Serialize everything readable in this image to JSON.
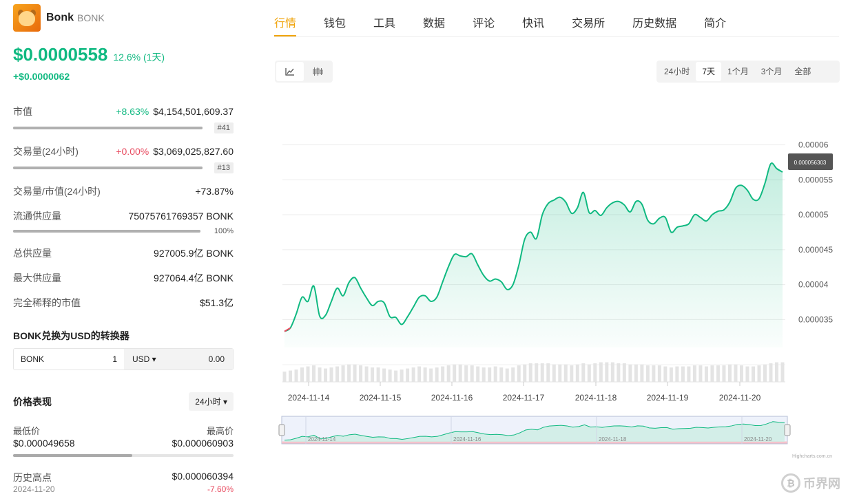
{
  "coin": {
    "name": "Bonk",
    "symbol": "BONK"
  },
  "price": {
    "value": "$0.0000558",
    "change_pct": "12.6% (1天)",
    "change_abs": "+$0.0000062"
  },
  "stats": {
    "market_cap": {
      "label": "市值",
      "change": "+8.63%",
      "value": "$4,154,501,609.37",
      "rank": "#41"
    },
    "volume": {
      "label": "交易量(24小时)",
      "change": "+0.00%",
      "value": "$3,069,025,827.60",
      "rank": "#13"
    },
    "vol_mcap": {
      "label": "交易量/市值(24小时)",
      "value": "+73.87%"
    },
    "circulating": {
      "label": "流通供应量",
      "value": "75075761769357 BONK",
      "pct": "100%",
      "pct_num": 100
    },
    "total_supply": {
      "label": "总供应量",
      "value": "927005.9亿 BONK"
    },
    "max_supply": {
      "label": "最大供应量",
      "value": "927064.4亿 BONK"
    },
    "fdv": {
      "label": "完全稀释的市值",
      "value": "$51.3亿"
    }
  },
  "converter": {
    "title": "BONK兑换为USD的转换器",
    "from_symbol": "BONK",
    "from_amount": "1",
    "to_currency": "USD ▾",
    "to_amount": "0.00"
  },
  "performance": {
    "title": "价格表现",
    "period": "24小时 ▾",
    "low_label": "最低价",
    "high_label": "最高价",
    "low": "$0.000049658",
    "high": "$0.000060903",
    "position_pct": 54,
    "ath_label": "历史高点",
    "ath_value": "$0.000060394",
    "ath_date": "2024-11-20",
    "ath_change": "-7.60%"
  },
  "tabs": [
    "行情",
    "钱包",
    "工具",
    "数据",
    "评论",
    "快讯",
    "交易所",
    "历史数据",
    "简介"
  ],
  "range_tabs": [
    "24小时",
    "7天",
    "1个月",
    "3个月",
    "全部"
  ],
  "active_range": "7天",
  "chart_icons": [
    "line-chart-icon",
    "candlestick-icon"
  ],
  "colors": {
    "up": "#10b981",
    "down": "#e84a5f",
    "accent": "#f0a40c"
  },
  "credit": "Highcharts.com.cn",
  "watermark": "币界网",
  "chart_data": {
    "type": "area",
    "x_labels": [
      "2024-11-14",
      "2024-11-15",
      "2024-11-16",
      "2024-11-17",
      "2024-11-18",
      "2024-11-19",
      "2024-11-20"
    ],
    "y_ticks": [
      "0.00006",
      "0.000055",
      "0.00005",
      "0.000045",
      "0.00004",
      "0.000035"
    ],
    "ylim": [
      3.1e-05,
      6.3e-05
    ],
    "tooltip": "0.000056303",
    "navigator_labels": [
      "2024-11-14",
      "2024-11-16",
      "2024-11-18",
      "2024-11-20"
    ],
    "values": [
      3.33e-05,
      3.38e-05,
      3.58e-05,
      3.82e-05,
      3.76e-05,
      3.98e-05,
      3.55e-05,
      3.56e-05,
      3.76e-05,
      3.95e-05,
      3.84e-05,
      4.03e-05,
      4.1e-05,
      3.95e-05,
      3.81e-05,
      3.7e-05,
      3.76e-05,
      3.74e-05,
      3.54e-05,
      3.53e-05,
      3.43e-05,
      3.54e-05,
      3.68e-05,
      3.82e-05,
      3.84e-05,
      3.76e-05,
      3.82e-05,
      4.04e-05,
      4.26e-05,
      4.43e-05,
      4.41e-05,
      4.4e-05,
      4.44e-05,
      4.28e-05,
      4.13e-05,
      4.05e-05,
      4.08e-05,
      4.04e-05,
      3.93e-05,
      4e-05,
      4.28e-05,
      4.65e-05,
      4.75e-05,
      4.66e-05,
      5e-05,
      5.16e-05,
      5.21e-05,
      5.25e-05,
      5.18e-05,
      5.02e-05,
      5.1e-05,
      5.32e-05,
      5.03e-05,
      5.06e-05,
      4.99e-05,
      5.1e-05,
      5.17e-05,
      5.19e-05,
      5.14e-05,
      5.04e-05,
      5.19e-05,
      5.15e-05,
      4.92e-05,
      4.87e-05,
      4.95e-05,
      4.96e-05,
      4.75e-05,
      4.82e-05,
      4.84e-05,
      4.87e-05,
      5e-05,
      4.96e-05,
      4.91e-05,
      5e-05,
      5.05e-05,
      5.07e-05,
      5.18e-05,
      5.38e-05,
      5.42e-05,
      5.35e-05,
      5.22e-05,
      5.23e-05,
      5.45e-05,
      5.73e-05,
      5.66e-05,
      5.61e-05
    ],
    "volume": [
      0.5,
      0.55,
      0.6,
      0.7,
      0.75,
      0.8,
      0.7,
      0.65,
      0.7,
      0.75,
      0.8,
      0.85,
      0.85,
      0.8,
      0.75,
      0.7,
      0.7,
      0.65,
      0.6,
      0.55,
      0.6,
      0.65,
      0.7,
      0.75,
      0.7,
      0.65,
      0.7,
      0.75,
      0.8,
      0.85,
      0.85,
      0.8,
      0.8,
      0.75,
      0.7,
      0.7,
      0.75,
      0.7,
      0.65,
      0.7,
      0.8,
      0.85,
      0.9,
      0.9,
      0.9,
      0.9,
      0.85,
      0.85,
      0.85,
      0.8,
      0.85,
      0.9,
      0.85,
      0.9,
      0.95,
      0.95,
      0.95,
      0.9,
      0.9,
      0.85,
      0.85,
      0.85,
      0.8,
      0.8,
      0.8,
      0.75,
      0.7,
      0.75,
      0.75,
      0.75,
      0.8,
      0.8,
      0.75,
      0.8,
      0.8,
      0.8,
      0.85,
      0.85,
      0.8,
      0.75,
      0.75,
      0.8,
      0.85,
      0.9,
      0.95,
      0.95
    ]
  }
}
